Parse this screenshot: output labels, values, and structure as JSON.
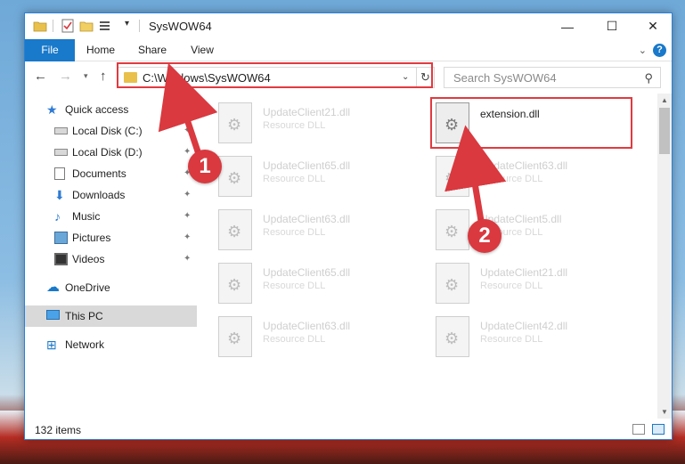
{
  "window": {
    "title": "SysWOW64",
    "minimize": "—",
    "maximize": "☐",
    "close": "✕"
  },
  "ribbon": {
    "tabs": [
      "File",
      "Home",
      "Share",
      "View"
    ],
    "expand": "⌄",
    "help": "?"
  },
  "nav": {
    "back": "←",
    "forward": "→",
    "recent": "▾",
    "up": "↑",
    "address": "C:\\Windows\\SysWOW64",
    "address_drop": "⌄",
    "refresh": "↻",
    "search_placeholder": "Search SysWOW64",
    "search_icon": "⚲"
  },
  "sidebar": {
    "items": [
      {
        "label": "Quick access",
        "icon": "star-icon",
        "pinned": false
      },
      {
        "label": "Local Disk (C:)",
        "icon": "drive-icon",
        "pinned": true
      },
      {
        "label": "Local Disk (D:)",
        "icon": "drive-icon",
        "pinned": true
      },
      {
        "label": "Documents",
        "icon": "documents-icon",
        "pinned": true
      },
      {
        "label": "Downloads",
        "icon": "download-icon",
        "pinned": true
      },
      {
        "label": "Music",
        "icon": "music-icon",
        "pinned": true
      },
      {
        "label": "Pictures",
        "icon": "pictures-icon",
        "pinned": true
      },
      {
        "label": "Videos",
        "icon": "videos-icon",
        "pinned": true
      },
      {
        "label": "OneDrive",
        "icon": "cloud-icon",
        "pinned": false
      },
      {
        "label": "This PC",
        "icon": "pc-icon",
        "pinned": false,
        "selected": true
      },
      {
        "label": "Network",
        "icon": "network-icon",
        "pinned": false
      }
    ],
    "pin_glyph": "📌"
  },
  "files": [
    {
      "name": "UpdateClient21.dll",
      "desc": "Resource DLL"
    },
    {
      "name": "extension.dll",
      "desc": "",
      "highlight": true
    },
    {
      "name": "UpdateClient65.dll",
      "desc": "Resource DLL"
    },
    {
      "name": "UpdateClient63.dll",
      "desc": "Resource DLL"
    },
    {
      "name": "UpdateClient63.dll",
      "desc": "Resource DLL"
    },
    {
      "name": "UpdateClient5.dll",
      "desc": "Resource DLL"
    },
    {
      "name": "UpdateClient65.dll",
      "desc": "Resource DLL"
    },
    {
      "name": "UpdateClient21.dll",
      "desc": "Resource DLL"
    },
    {
      "name": "UpdateClient63.dll",
      "desc": "Resource DLL"
    },
    {
      "name": "UpdateClient42.dll",
      "desc": "Resource DLL"
    }
  ],
  "status": {
    "item_count": "132 items"
  },
  "callouts": {
    "step1": "1",
    "step2": "2"
  },
  "colors": {
    "accent": "#1979ca",
    "callout_red": "#e23a3f",
    "badge_red": "#d9393f"
  }
}
